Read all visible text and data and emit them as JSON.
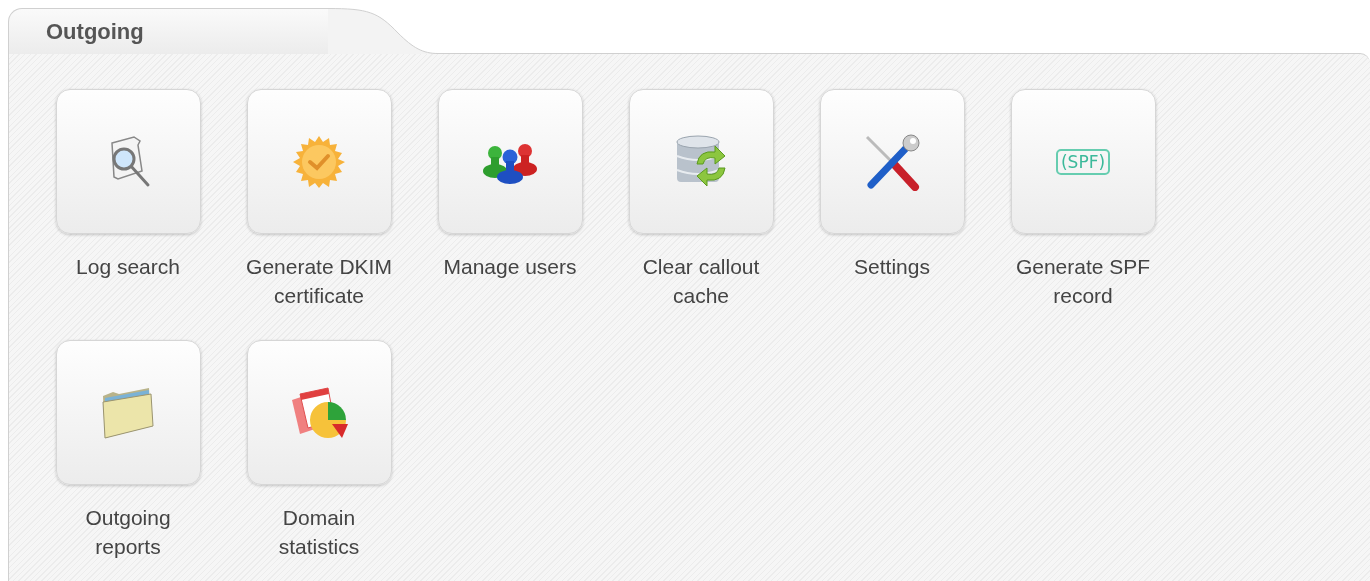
{
  "panel": {
    "title": "Outgoing"
  },
  "tools": [
    {
      "kind": "log-search",
      "label": "Log search"
    },
    {
      "kind": "certificate",
      "label": "Generate DKIM certificate"
    },
    {
      "kind": "users",
      "label": "Manage users"
    },
    {
      "kind": "cache",
      "label": "Clear callout cache"
    },
    {
      "kind": "settings",
      "label": "Settings"
    },
    {
      "kind": "spf",
      "label": "Generate SPF record",
      "icon_text": "(SPF)"
    },
    {
      "kind": "folder",
      "label": "Outgoing reports"
    },
    {
      "kind": "statistics",
      "label": "Domain statistics"
    }
  ]
}
